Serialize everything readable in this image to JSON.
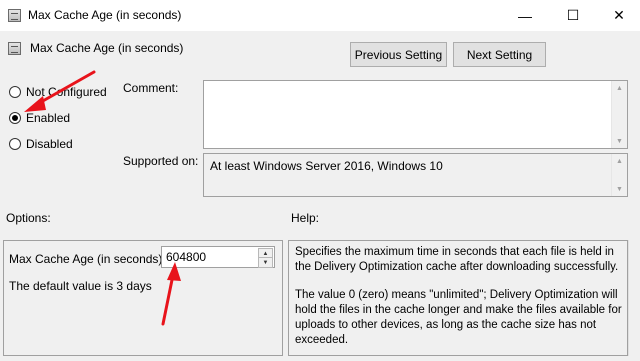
{
  "window": {
    "title": "Max Cache Age (in seconds)",
    "minimize": "—",
    "maximize": "☐",
    "close": "✕"
  },
  "header": {
    "title": "Max Cache Age (in seconds)",
    "prev_button": "Previous Setting",
    "next_button": "Next Setting"
  },
  "state": {
    "options": [
      {
        "label": "Not Configured",
        "selected": false
      },
      {
        "label": "Enabled",
        "selected": true
      },
      {
        "label": "Disabled",
        "selected": false
      }
    ]
  },
  "comment": {
    "label": "Comment:",
    "value": ""
  },
  "supported": {
    "label": "Supported on:",
    "value": "At least Windows Server 2016, Windows 10"
  },
  "options_panel": {
    "heading": "Options:",
    "field_label": "Max Cache Age (in seconds):",
    "field_value": "604800",
    "note": "The default value is 3 days"
  },
  "help_panel": {
    "heading": "Help:",
    "paragraphs": [
      "Specifies the maximum time in seconds that each file is held in the Delivery Optimization cache after downloading successfully.",
      "The value 0 (zero) means \"unlimited\"; Delivery Optimization will hold the files in the cache longer and make the files available for uploads to other devices, as long as the cache size has not exceeded."
    ]
  },
  "annotations": {
    "arrow_color": "#e8131b"
  }
}
